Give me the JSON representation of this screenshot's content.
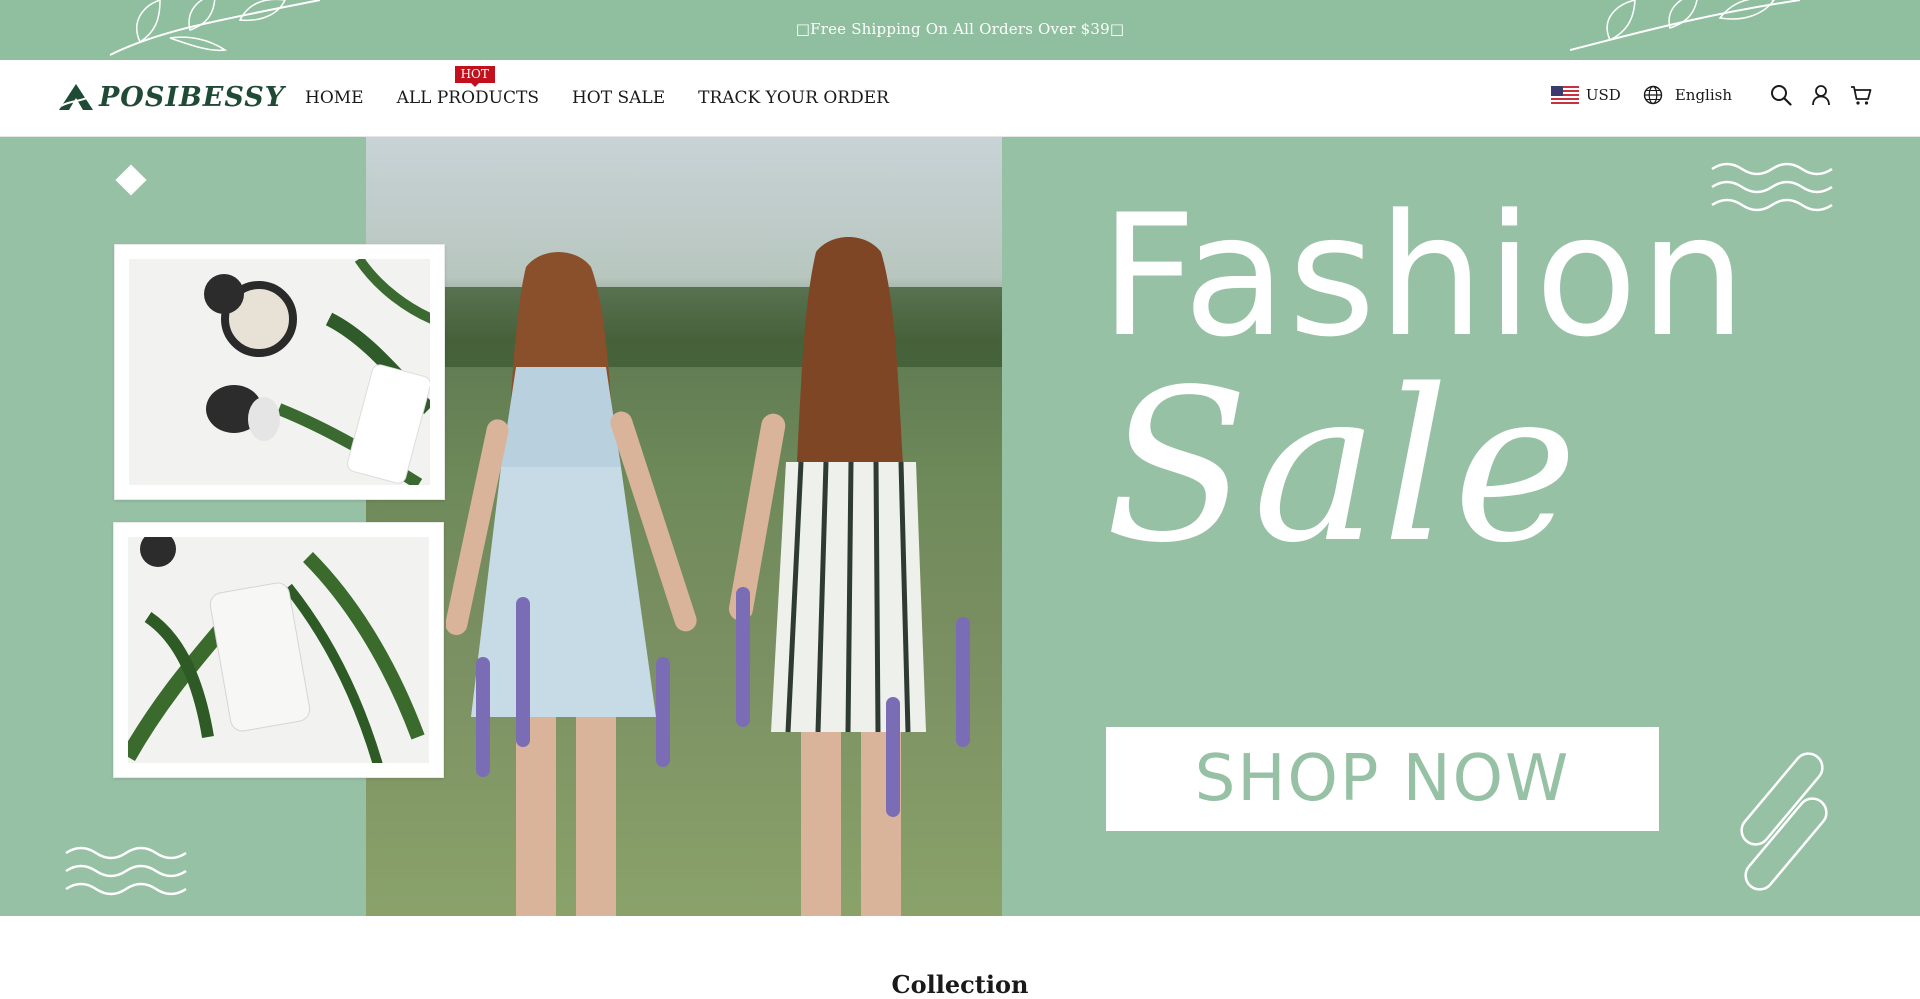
{
  "announcement": {
    "text": "□Free Shipping On All Orders Over $39□"
  },
  "header": {
    "logo_text": "POSIBESSY",
    "nav": [
      {
        "label": "HOME"
      },
      {
        "label": "ALL PRODUCTS",
        "badge": "HOT"
      },
      {
        "label": "HOT SALE"
      },
      {
        "label": "TRACK YOUR ORDER"
      }
    ],
    "currency": "USD",
    "language": "English",
    "icons": [
      "flag-us-icon",
      "globe-icon",
      "search-icon",
      "user-icon",
      "cart-icon"
    ]
  },
  "hero": {
    "headline": "Fashion",
    "subheadline": "Sale",
    "cta_label": "SHOP NOW"
  },
  "section": {
    "title": "Collection"
  },
  "colors": {
    "brand_green": "#97c1a5",
    "badge_red": "#c2101d",
    "logo_green": "#1f4a36"
  }
}
